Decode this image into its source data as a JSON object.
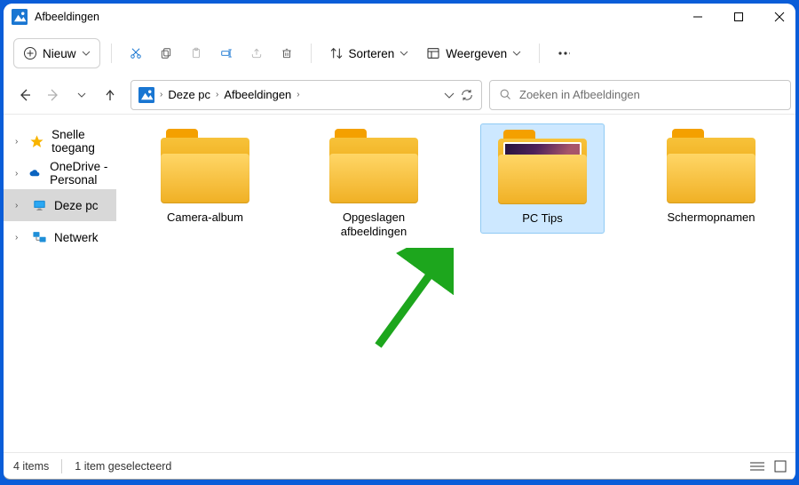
{
  "titlebar": {
    "title": "Afbeeldingen"
  },
  "toolbar": {
    "new_label": "Nieuw",
    "sort_label": "Sorteren",
    "view_label": "Weergeven"
  },
  "breadcrumb": {
    "parts": [
      "Deze pc",
      "Afbeeldingen"
    ]
  },
  "search": {
    "placeholder": "Zoeken in Afbeeldingen"
  },
  "sidebar": {
    "items": [
      {
        "label": "Snelle toegang"
      },
      {
        "label": "OneDrive - Personal"
      },
      {
        "label": "Deze pc"
      },
      {
        "label": "Netwerk"
      }
    ]
  },
  "folders": [
    {
      "name": "Camera-album"
    },
    {
      "name": "Opgeslagen afbeeldingen"
    },
    {
      "name": "PC Tips"
    },
    {
      "name": "Schermopnamen"
    }
  ],
  "status": {
    "count": "4 items",
    "selected": "1 item geselecteerd"
  }
}
